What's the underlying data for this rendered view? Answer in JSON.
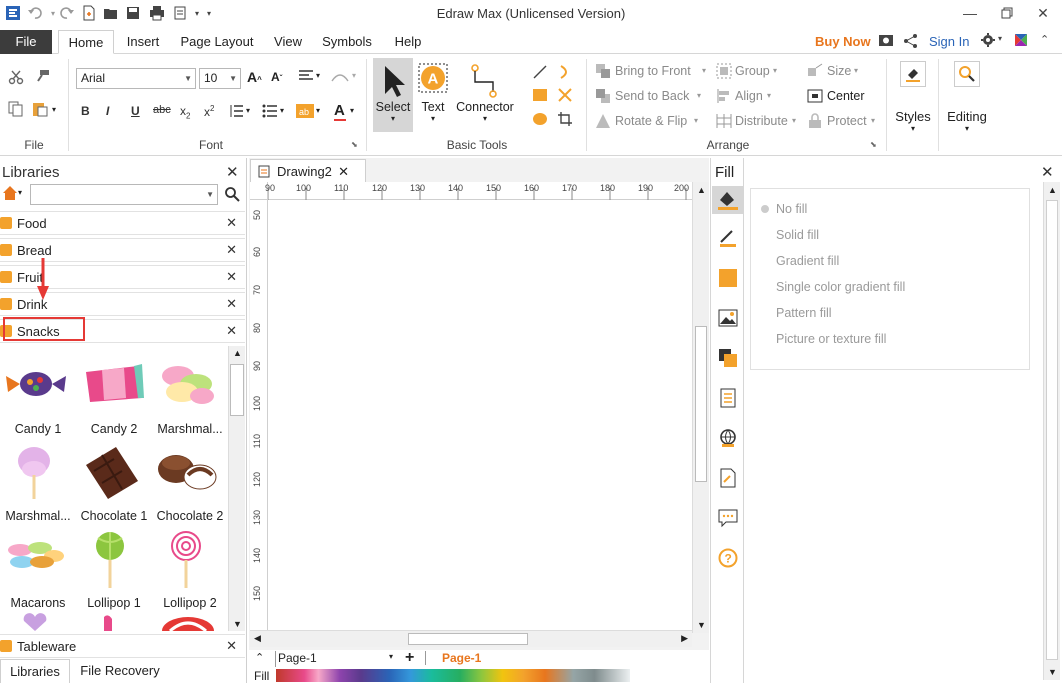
{
  "app": {
    "title": "Edraw Max (Unlicensed Version)"
  },
  "menu": {
    "file": "File",
    "tabs": [
      "Home",
      "Insert",
      "Page Layout",
      "View",
      "Symbols",
      "Help"
    ],
    "buy_now": "Buy Now",
    "sign_in": "Sign In"
  },
  "ribbon": {
    "file_group": "File",
    "font": {
      "family": "Arial",
      "size": "10",
      "group": "Font"
    },
    "basic_tools": {
      "select": "Select",
      "text": "Text",
      "connector": "Connector",
      "group": "Basic Tools"
    },
    "arrange": {
      "bring_to_front": "Bring to Front",
      "send_to_back": "Send to Back",
      "rotate_flip": "Rotate & Flip",
      "group": "Group",
      "align": "Align",
      "distribute": "Distribute",
      "size": "Size",
      "center": "Center",
      "protect": "Protect",
      "group_label": "Arrange"
    },
    "styles": "Styles",
    "editing": "Editing"
  },
  "libraries": {
    "title": "Libraries",
    "items": [
      "Food",
      "Bread",
      "Fruit",
      "Drink",
      "Snacks"
    ],
    "shapes": [
      "Candy 1",
      "Candy 2",
      "Marshmal...",
      "Marshmal...",
      "Chocolate 1",
      "Chocolate 2",
      "Macarons",
      "Lollipop 1",
      "Lollipop 2"
    ],
    "footer_item": "Tableware",
    "bottom_tabs": [
      "Libraries",
      "File Recovery"
    ]
  },
  "document": {
    "tab": "Drawing2",
    "ruler_h": [
      "90",
      "100",
      "110",
      "120",
      "130",
      "140",
      "150",
      "160",
      "170",
      "180",
      "190",
      "200"
    ],
    "ruler_v": [
      "50",
      "60",
      "70",
      "80",
      "90",
      "100",
      "110",
      "120",
      "130",
      "140",
      "150"
    ],
    "page_select": "Page-1",
    "page_tab": "Page-1",
    "fill_label": "Fill"
  },
  "fill_panel": {
    "title": "Fill",
    "options": [
      "No fill",
      "Solid fill",
      "Gradient fill",
      "Single color gradient fill",
      "Pattern fill",
      "Picture or texture fill"
    ]
  },
  "colors": {
    "accent": "#f3a22c",
    "highlight": "#e53935",
    "file_tab": "#3c3c3c",
    "link": "#2a64b7",
    "buy": "#e8761e"
  }
}
